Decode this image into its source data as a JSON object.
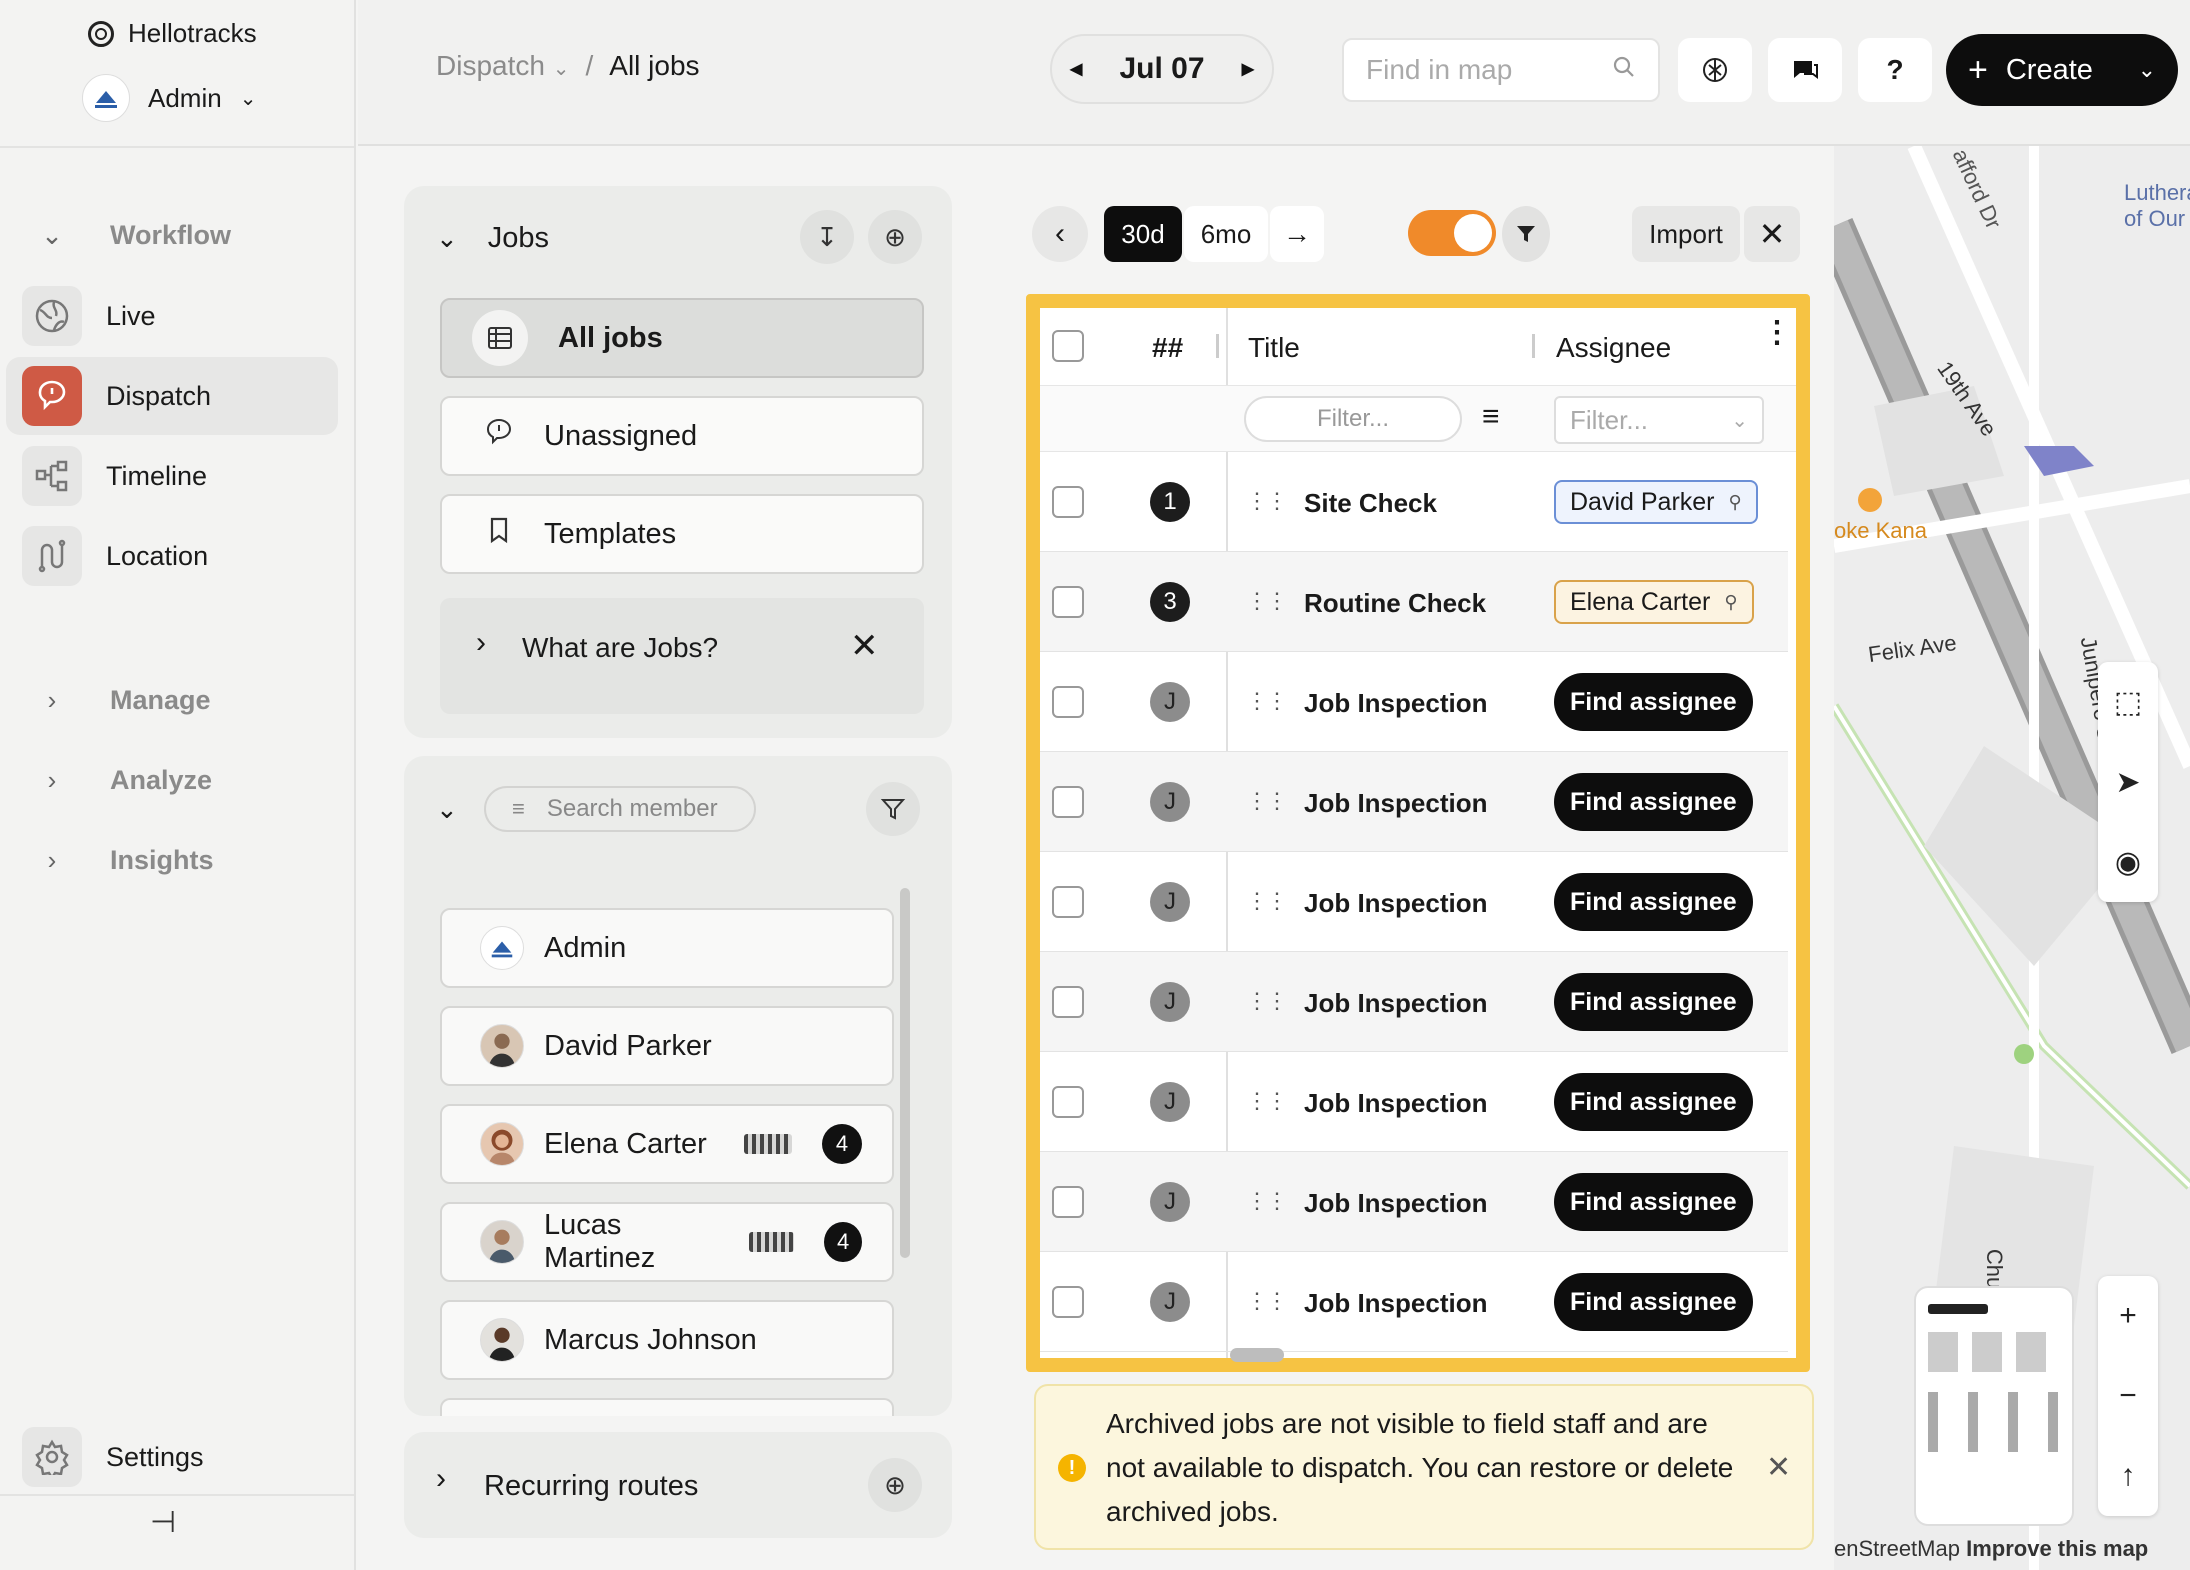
{
  "app": {
    "name": "Hellotracks",
    "account": "Admin"
  },
  "nav": {
    "workflow": "Workflow",
    "items": [
      {
        "label": "Live"
      },
      {
        "label": "Dispatch"
      },
      {
        "label": "Timeline"
      },
      {
        "label": "Location"
      }
    ],
    "manage": "Manage",
    "analyze": "Analyze",
    "insights": "Insights",
    "settings": "Settings"
  },
  "header": {
    "breadcrumb_parent": "Dispatch",
    "breadcrumb_sep": "/",
    "breadcrumb_current": "All jobs",
    "date": "Jul 07",
    "find_placeholder": "Find in map",
    "help": "?",
    "create": "Create"
  },
  "jobs_panel": {
    "title": "Jobs",
    "views": [
      {
        "label": "All jobs"
      },
      {
        "label": "Unassigned"
      },
      {
        "label": "Templates"
      }
    ],
    "info": "What are Jobs?"
  },
  "members_panel": {
    "search_placeholder": "Search member",
    "members": [
      {
        "name": "Admin",
        "count": ""
      },
      {
        "name": "David Parker",
        "count": ""
      },
      {
        "name": "Elena Carter",
        "count": "4"
      },
      {
        "name": "Lucas Martinez",
        "count": "4"
      },
      {
        "name": "Marcus Johnson",
        "count": ""
      }
    ]
  },
  "recurring": {
    "title": "Recurring routes"
  },
  "toolbar": {
    "range_30d": "30d",
    "range_6mo": "6mo",
    "import": "Import"
  },
  "table": {
    "col_num": "##",
    "col_title": "Title",
    "col_assignee": "Assignee",
    "filter_placeholder": "Filter...",
    "rows": [
      {
        "num": "1",
        "title": "Site Check",
        "assignee": "David Parker",
        "style": "dark"
      },
      {
        "num": "3",
        "title": "Routine Check",
        "assignee": "Elena Carter",
        "style": "dark"
      },
      {
        "num": "J",
        "title": "Job Inspection",
        "assignee": "Find assignee",
        "style": "grey"
      },
      {
        "num": "J",
        "title": "Job Inspection",
        "assignee": "Find assignee",
        "style": "grey"
      },
      {
        "num": "J",
        "title": "Job Inspection",
        "assignee": "Find assignee",
        "style": "grey"
      },
      {
        "num": "J",
        "title": "Job Inspection",
        "assignee": "Find assignee",
        "style": "grey"
      },
      {
        "num": "J",
        "title": "Job Inspection",
        "assignee": "Find assignee",
        "style": "grey"
      },
      {
        "num": "J",
        "title": "Job Inspection",
        "assignee": "Find assignee",
        "style": "grey"
      },
      {
        "num": "J",
        "title": "Job Inspection",
        "assignee": "Find assignee",
        "style": "grey"
      }
    ]
  },
  "archive_notice": "Archived jobs are not visible to field staff and are not available to dispatch. You can restore or delete archived jobs.",
  "map": {
    "labels": {
      "street1": "afford Dr",
      "street2": "19th Ave",
      "street3": "Felix Ave",
      "street4": "Junipero S",
      "street5": "Chu",
      "poi": "oke Kana",
      "poi2": "Luthera of Our"
    },
    "attribution": "enStreetMap",
    "improve": "Improve this map"
  },
  "colors": {
    "accent": "#f6c343",
    "dispatch": "#cf5a45",
    "toggle": "#f08a2a"
  }
}
